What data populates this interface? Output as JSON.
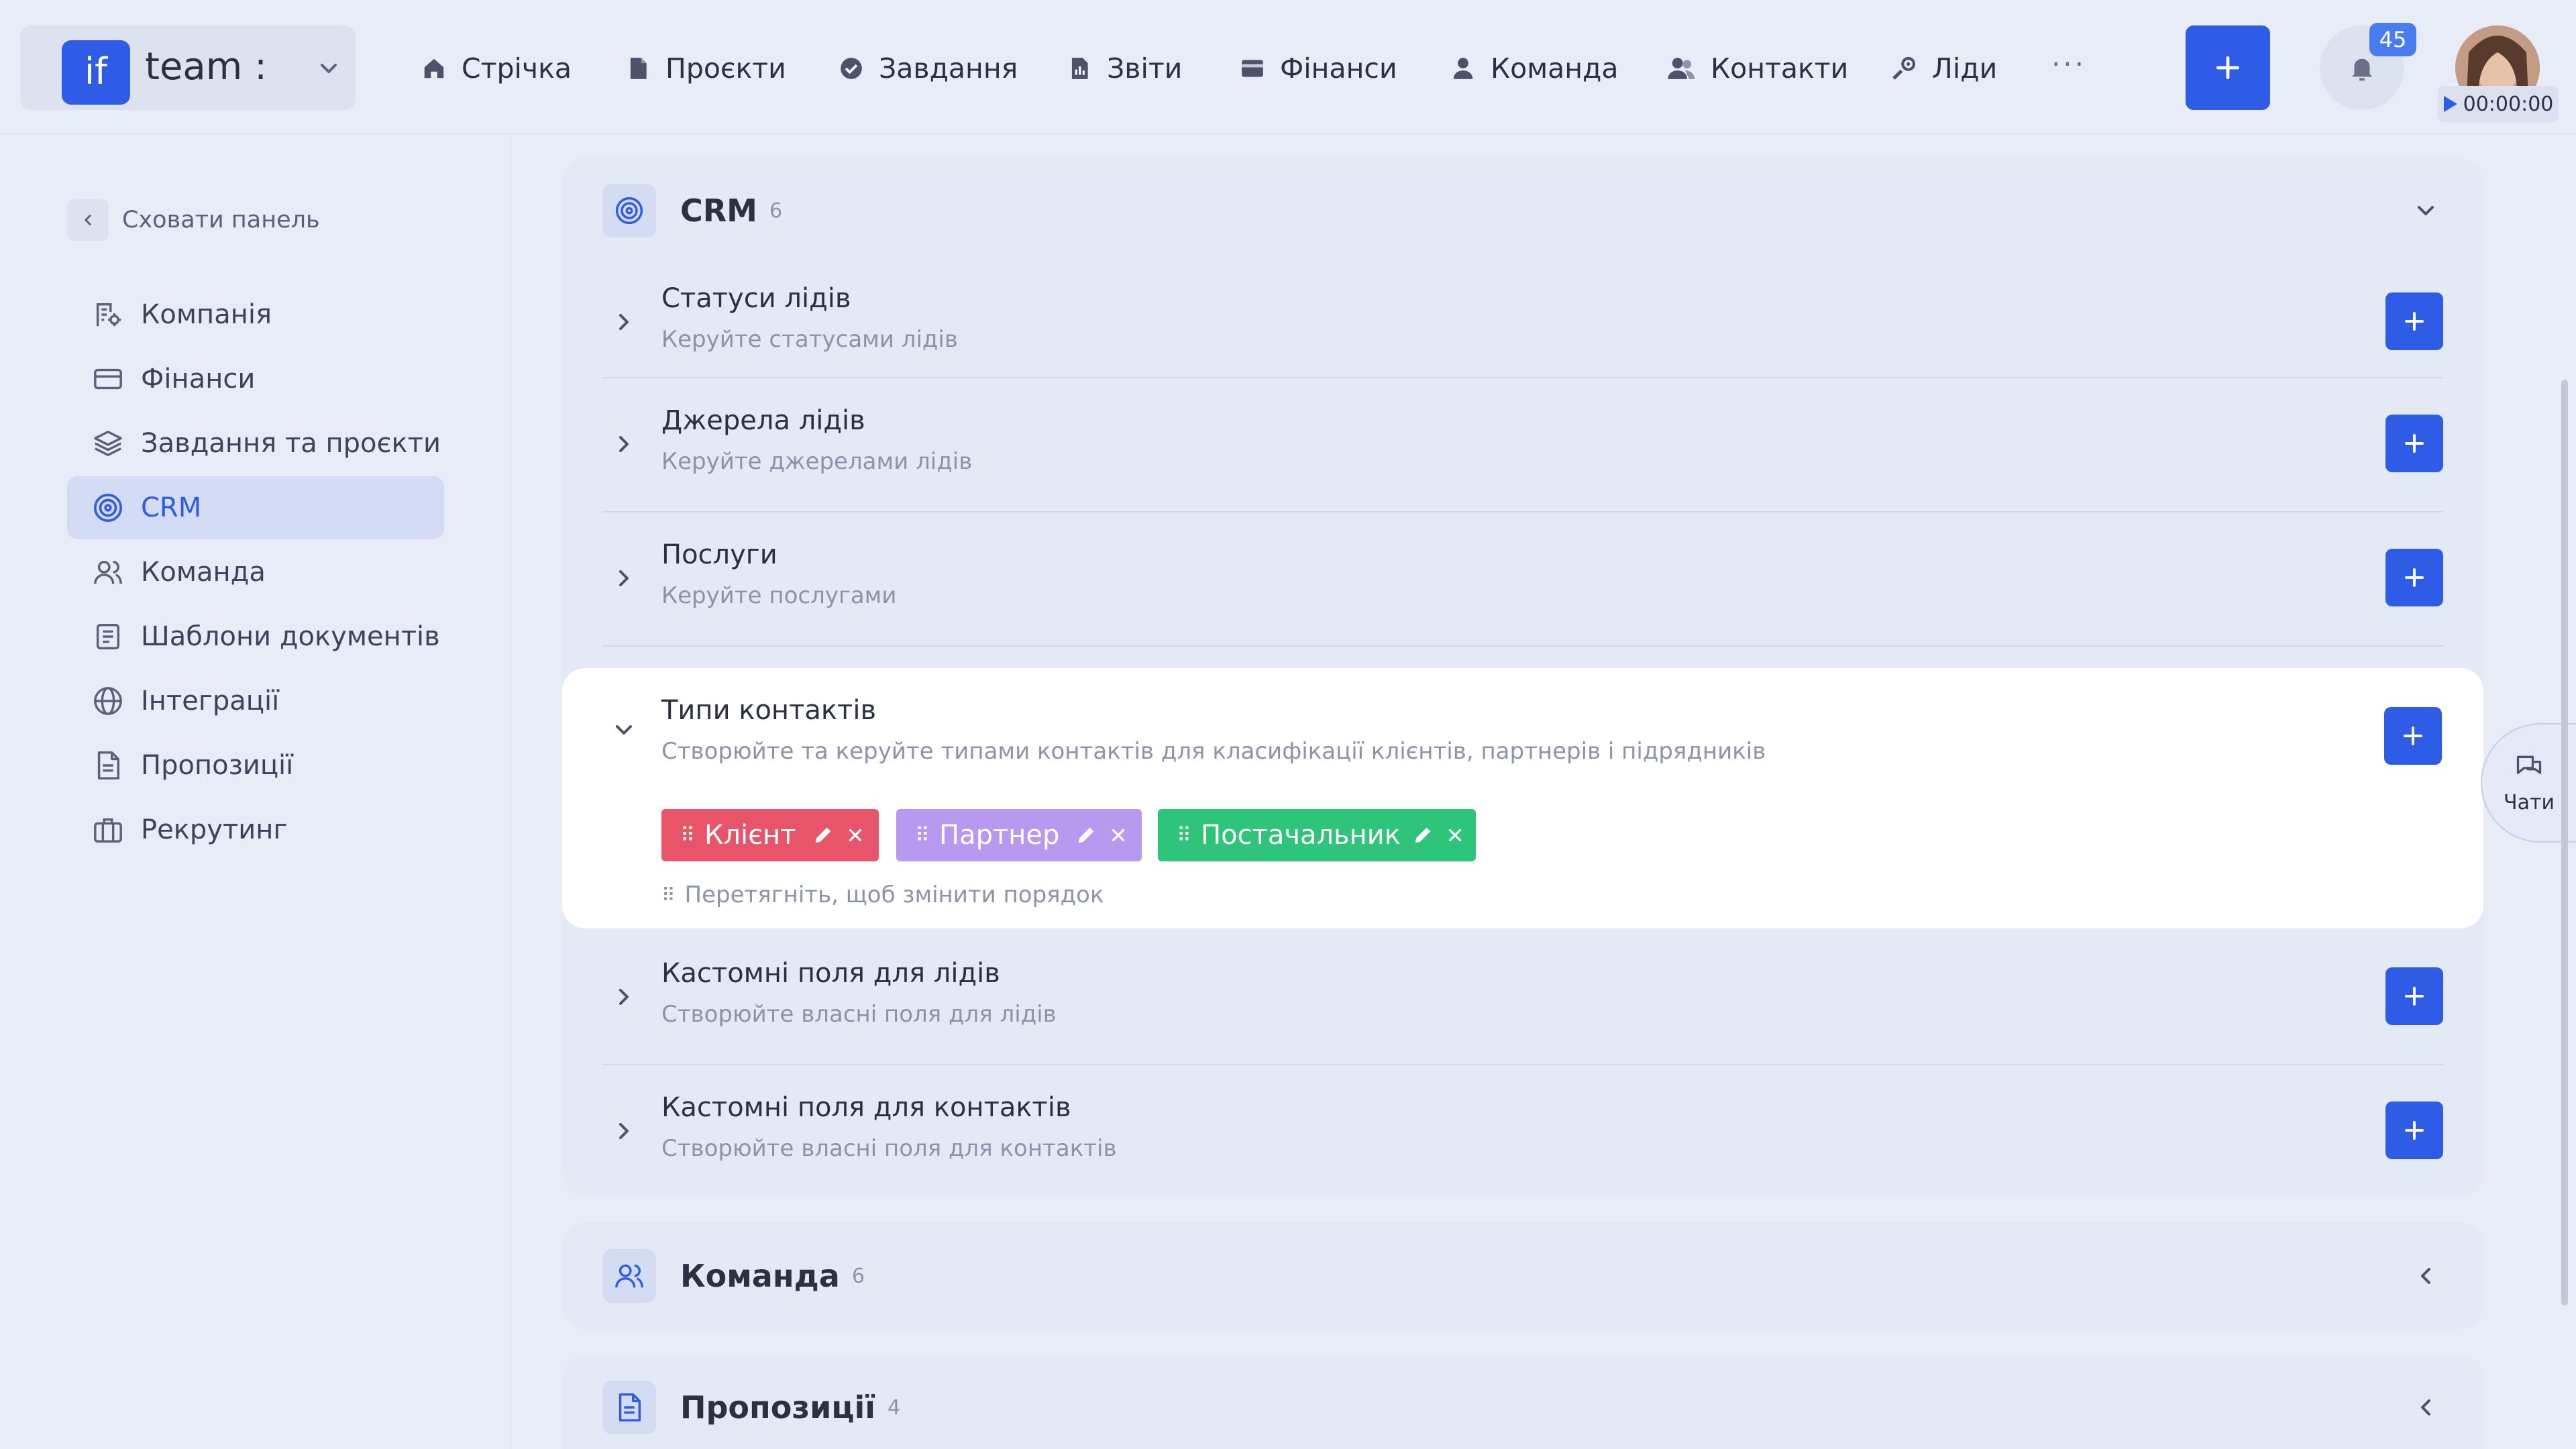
{
  "header": {
    "logo_text": "if",
    "team_name": "team :",
    "nav": [
      {
        "label": "Стрічка",
        "icon": "home-icon"
      },
      {
        "label": "Проєкти",
        "icon": "document-icon"
      },
      {
        "label": "Завдання",
        "icon": "check-circle-icon"
      },
      {
        "label": "Звіти",
        "icon": "report-icon"
      },
      {
        "label": "Фінанси",
        "icon": "wallet-icon"
      },
      {
        "label": "Команда",
        "icon": "user-icon"
      },
      {
        "label": "Контакти",
        "icon": "contacts-icon"
      },
      {
        "label": "Ліди",
        "icon": "leads-icon"
      }
    ],
    "more_label": "···",
    "notifications_count": "45",
    "timer": "00:00:00"
  },
  "sidebar": {
    "hide_label": "Сховати панель",
    "items": [
      {
        "label": "Компанія",
        "icon": "building-icon"
      },
      {
        "label": "Фінанси",
        "icon": "card-icon"
      },
      {
        "label": "Завдання та проєкти",
        "icon": "layers-icon"
      },
      {
        "label": "CRM",
        "icon": "target-icon",
        "active": true
      },
      {
        "label": "Команда",
        "icon": "team-icon"
      },
      {
        "label": "Шаблони документів",
        "icon": "template-icon"
      },
      {
        "label": "Інтеграції",
        "icon": "globe-icon"
      },
      {
        "label": "Пропозиції",
        "icon": "proposal-icon"
      },
      {
        "label": "Рекрутинг",
        "icon": "briefcase-icon"
      }
    ]
  },
  "crm": {
    "title": "CRM",
    "count": "6",
    "sections": [
      {
        "title": "Статуси лідів",
        "subtitle": "Керуйте статусами лідів"
      },
      {
        "title": "Джерела лідів",
        "subtitle": "Керуйте джерелами лідів"
      },
      {
        "title": "Послуги",
        "subtitle": "Керуйте послугами"
      },
      {
        "title": "Типи контактів",
        "subtitle": "Створюйте та керуйте типами контактів для класифікації клієнтів, партнерів і підрядників"
      },
      {
        "title": "Кастомні поля для лідів",
        "subtitle": "Створюйте власні поля для лідів"
      },
      {
        "title": "Кастомні поля для контактів",
        "subtitle": "Створюйте власні поля для контактів"
      }
    ],
    "contact_types": [
      {
        "label": "Клієнт",
        "color": "#e8556a"
      },
      {
        "label": "Партнер",
        "color": "#b79af0"
      },
      {
        "label": "Постачальник",
        "color": "#2ec47a"
      }
    ],
    "drag_hint": "Перетягніть, щоб змінити порядок"
  },
  "team_card": {
    "title": "Команда",
    "count": "6"
  },
  "proposals_card": {
    "title": "Пропозиції",
    "count": "4"
  },
  "chat": {
    "label": "Чати"
  },
  "colors": {
    "accent": "#2f5ce6",
    "background": "#e8ecf7"
  }
}
